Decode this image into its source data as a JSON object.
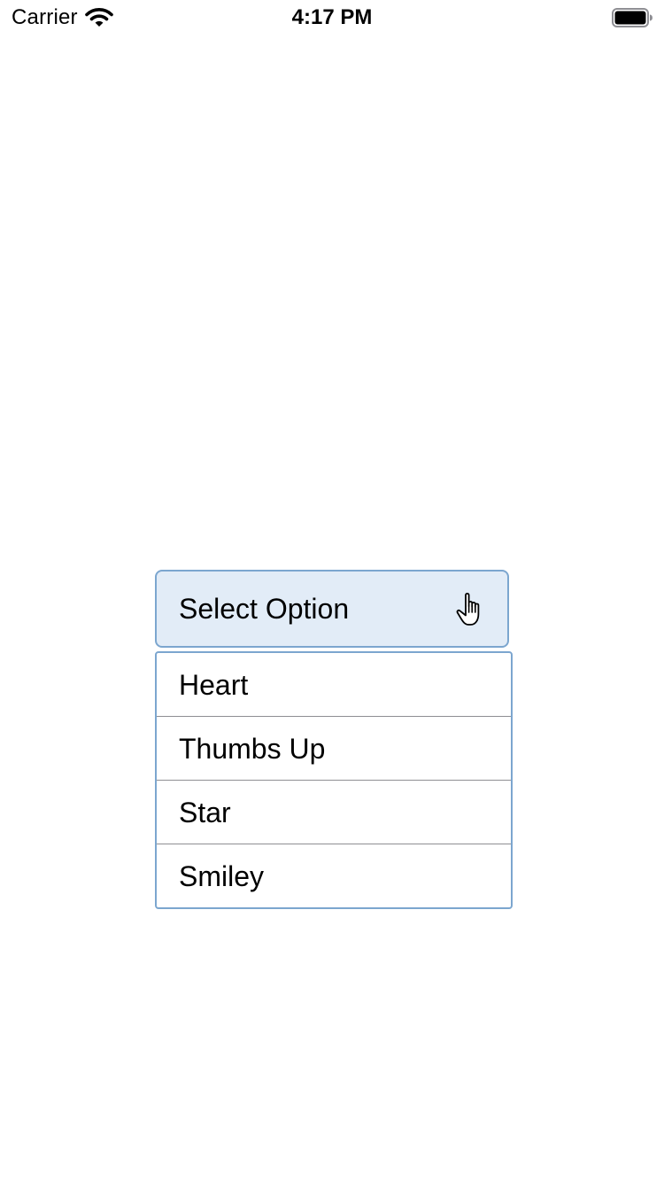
{
  "status_bar": {
    "carrier": "Carrier",
    "time": "4:17 PM",
    "wifi_icon": "wifi-icon",
    "battery_icon": "battery-icon"
  },
  "dropdown": {
    "label": "Select Option",
    "cursor_icon": "hand-pointer-icon",
    "accent_color": "#7ca6cf",
    "button_background": "#e2ecf7",
    "options": [
      {
        "label": "Heart"
      },
      {
        "label": "Thumbs Up"
      },
      {
        "label": "Star"
      },
      {
        "label": "Smiley"
      }
    ]
  }
}
